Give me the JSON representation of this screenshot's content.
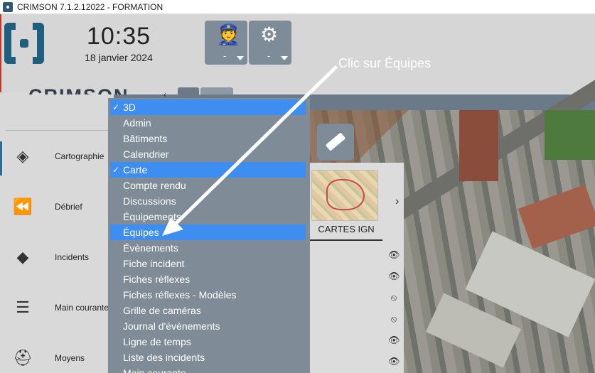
{
  "window": {
    "title": "CRIMSON 7.1.2.12022 - FORMATION"
  },
  "header": {
    "time": "10:35",
    "date": "18 janvier 2024",
    "buttons": [
      {
        "icon": "police-officer-icon",
        "value": "-"
      },
      {
        "icon": "settings-gear-icon",
        "value": "-"
      }
    ],
    "brand": "CRIMSON"
  },
  "tabs": [
    {
      "label": "3D",
      "active": false
    },
    {
      "label": "Carte",
      "active": true
    }
  ],
  "sidebar": {
    "items": [
      {
        "label": "Cartographie",
        "icon": "layers-icon"
      },
      {
        "label": "Débrief",
        "icon": "rewind-icon"
      },
      {
        "label": "Incidents",
        "icon": "alert-diamond-icon"
      },
      {
        "label": "Main courante",
        "icon": "list-book-icon"
      },
      {
        "label": "Moyens",
        "icon": "helmet-icon"
      }
    ]
  },
  "menu": {
    "items": [
      {
        "label": "3D",
        "checked": true,
        "highlighted": true
      },
      {
        "label": "Admin",
        "checked": false,
        "highlighted": false
      },
      {
        "label": "Bâtiments",
        "checked": false,
        "highlighted": false
      },
      {
        "label": "Calendrier",
        "checked": false,
        "highlighted": false
      },
      {
        "label": "Carte",
        "checked": true,
        "highlighted": true
      },
      {
        "label": "Compte rendu",
        "checked": false,
        "highlighted": false
      },
      {
        "label": "Discussions",
        "checked": false,
        "highlighted": false
      },
      {
        "label": "Équipements",
        "checked": false,
        "highlighted": false
      },
      {
        "label": "Équipes",
        "checked": false,
        "highlighted": true
      },
      {
        "label": "Évènements",
        "checked": false,
        "highlighted": false
      },
      {
        "label": "Fiche incident",
        "checked": false,
        "highlighted": false
      },
      {
        "label": "Fiches réflexes",
        "checked": false,
        "highlighted": false
      },
      {
        "label": "Fiches réflexes - Modèles",
        "checked": false,
        "highlighted": false
      },
      {
        "label": "Grille de caméras",
        "checked": false,
        "highlighted": false
      },
      {
        "label": "Journal d'évènements",
        "checked": false,
        "highlighted": false
      },
      {
        "label": "Ligne de temps",
        "checked": false,
        "highlighted": false
      },
      {
        "label": "Liste des incidents",
        "checked": false,
        "highlighted": false
      },
      {
        "label": "Main courante",
        "checked": false,
        "highlighted": false
      }
    ]
  },
  "map": {
    "layer_name": "CARTES IGN",
    "visibility": [
      "visible",
      "visible",
      "hidden",
      "hidden",
      "visible",
      "visible"
    ]
  },
  "annotation": {
    "text": "Clic sur Équipes"
  },
  "colors": {
    "accent_blue": "#3d8ef0",
    "brand_blue": "#1e5f80",
    "menu_bg": "#7f8c98",
    "window_border": "#c0392b"
  }
}
